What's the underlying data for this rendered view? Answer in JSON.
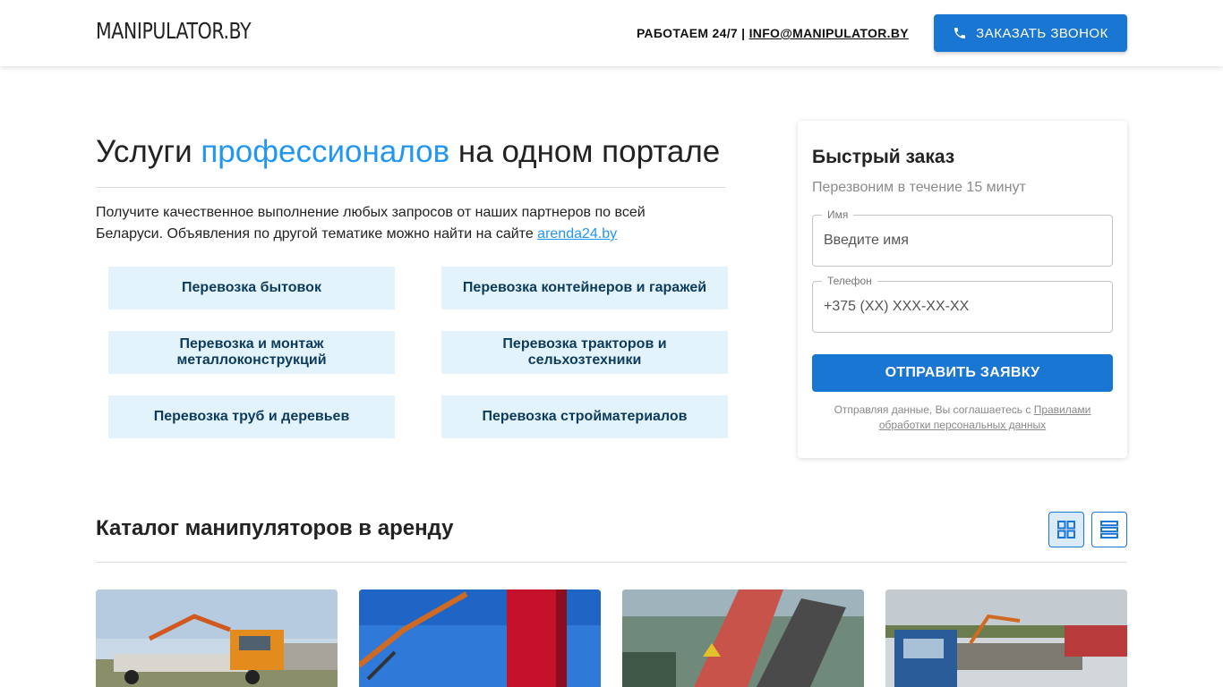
{
  "header": {
    "logo": "MANIPULATOR.BY",
    "hours": "РАБОТАЕМ 24/7 | ",
    "email": "INFO@MANIPULATOR.BY",
    "call_button": "ЗАКАЗАТЬ ЗВОНОК",
    "call_icon": "phone-icon"
  },
  "hero": {
    "title_before": "Услуги ",
    "title_accent": "профессионалов",
    "title_after": " на одном портале",
    "text": "Получите качественное выполнение любых запросов от наших партнеров по всей Беларуси. Объявления по другой тематике можно найти на сайте ",
    "link": "arenda24.by"
  },
  "services": [
    "Перевозка бытовок",
    "Перевозка контейнеров и гаражей",
    "Перевозка и монтаж металлоконструкций",
    "Перевозка тракторов и сельхозтехники",
    "Перевозка труб и деревьев",
    "Перевозка стройматериалов"
  ],
  "quick_order": {
    "title": "Быстрый заказ",
    "subtitle": "Перезвоним в течение 15 минут",
    "name_label": "Имя",
    "name_placeholder": "Введите имя",
    "phone_label": "Телефон",
    "phone_placeholder": "+375 (XX) XXX-XX-XX",
    "submit": "ОТПРАВИТЬ ЗАЯВКУ",
    "consent_text": "Отправляя данные, Вы соглашаетесь с ",
    "consent_link": "Правилами обработки персональных данных"
  },
  "catalog": {
    "title": "Каталог манипуляторов в аренду",
    "grid_icon": "grid-view-icon",
    "list_icon": "list-view-icon",
    "accent_color": "#1976d2"
  },
  "colors": {
    "primary": "#1976d2",
    "accent": "#2196f3",
    "service_bg": "#e3f3fc",
    "service_text": "#0d3b5c"
  }
}
